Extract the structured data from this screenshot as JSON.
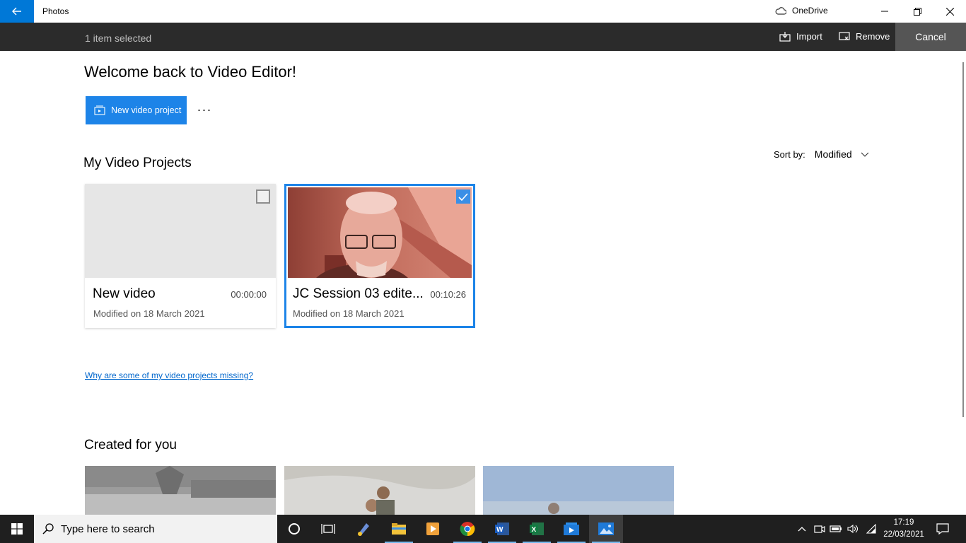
{
  "window": {
    "title": "Photos",
    "onedrive_label": "OneDrive"
  },
  "selection_bar": {
    "count_text": "1 item selected",
    "import_label": "Import",
    "remove_label": "Remove",
    "cancel_label": "Cancel"
  },
  "main": {
    "welcome_text": "Welcome back to Video Editor!",
    "new_project_label": "New video project",
    "more_label": "···",
    "projects_heading": "My Video Projects",
    "sort_label": "Sort by:",
    "sort_value": "Modified",
    "projects": [
      {
        "name": "New video",
        "duration": "00:00:00",
        "modified": "Modified on 18 March 2021",
        "selected": false
      },
      {
        "name": "JC Session 03 edite...",
        "duration": "00:10:26",
        "modified": "Modified on 18 March 2021",
        "selected": true
      }
    ],
    "missing_link": "Why are some of my video projects missing?",
    "created_heading": "Created for you"
  },
  "taskbar": {
    "search_placeholder": "Type here to search",
    "time": "17:19",
    "date": "22/03/2021",
    "pinned_icons": [
      "cortana-icon",
      "task-view-icon",
      "paint-icon",
      "file-explorer-icon",
      "media-player-icon",
      "chrome-icon",
      "word-icon",
      "excel-icon",
      "video-editor-icon",
      "photos-icon"
    ]
  },
  "colors": {
    "accent": "#0078d7",
    "button_blue": "#1d84e8",
    "selection_bar": "#2b2b2b",
    "taskbar": "#1f1f1f",
    "link": "#0066cc"
  }
}
